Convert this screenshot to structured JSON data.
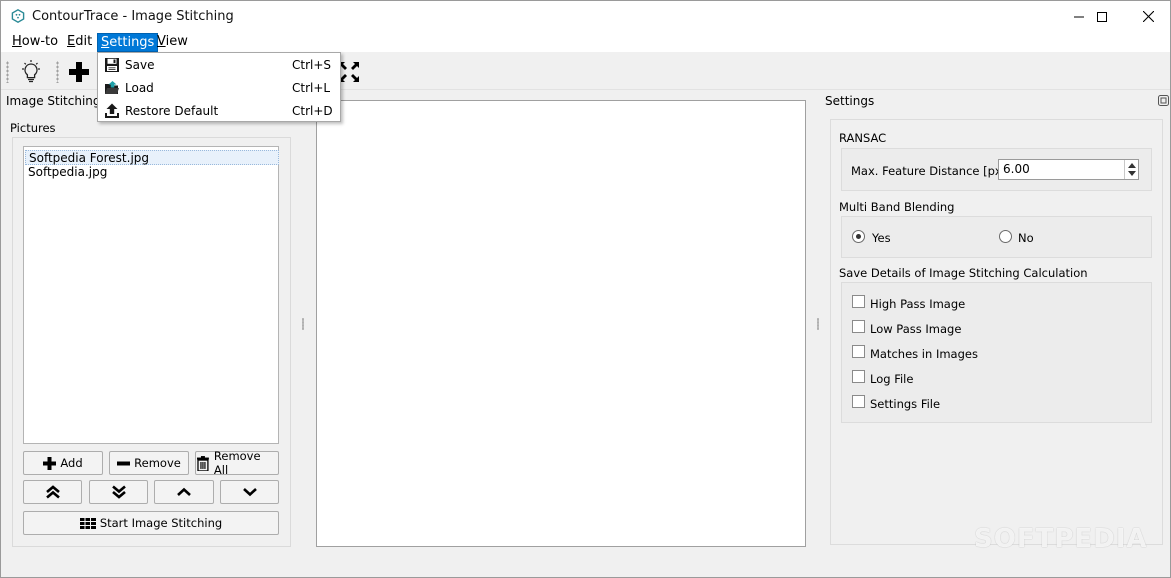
{
  "window": {
    "title": "ContourTrace - Image Stitching"
  },
  "menubar": {
    "items": [
      {
        "label": "How-to",
        "mnemonic": "H",
        "rest": "ow-to"
      },
      {
        "label": "Edit",
        "mnemonic": "E",
        "rest": "dit"
      },
      {
        "label": "Settings",
        "mnemonic": "S",
        "rest": "ettings"
      },
      {
        "label": "View",
        "mnemonic": "V",
        "rest": "iew"
      }
    ]
  },
  "settings_menu": {
    "items": [
      {
        "label": "Save",
        "shortcut": "Ctrl+S",
        "icon": "floppy-disk-icon"
      },
      {
        "label": "Load",
        "shortcut": "Ctrl+L",
        "icon": "open-folder-icon"
      },
      {
        "label": "Restore Default",
        "shortcut": "Ctrl+D",
        "icon": "upload-icon"
      }
    ]
  },
  "toolbar": {
    "icons": [
      "lightbulb-icon",
      "plus-icon",
      "fullscreen-icon"
    ]
  },
  "left_panel": {
    "title": "Image Stitching",
    "pictures_label": "Pictures",
    "pictures": [
      "Softpedia Forest.jpg",
      "Softpedia.jpg"
    ],
    "add_label": "Add",
    "remove_label": "Remove",
    "remove_all_label": "Remove All",
    "start_label": "Start Image Stitching"
  },
  "settings_panel": {
    "title": "Settings",
    "ransac": {
      "label": "RANSAC",
      "field_label": "Max. Feature Distance [px]:",
      "field_value": "6.00"
    },
    "blending": {
      "label": "Multi Band Blending",
      "yes_label": "Yes",
      "no_label": "No",
      "selected": "Yes"
    },
    "save_details": {
      "label": "Save Details of Image Stitching Calculation",
      "options": [
        {
          "label": "High Pass Image",
          "checked": false
        },
        {
          "label": "Low Pass Image",
          "checked": false
        },
        {
          "label": "Matches in Images",
          "checked": false
        },
        {
          "label": "Log File",
          "checked": false
        },
        {
          "label": "Settings File",
          "checked": false
        }
      ]
    }
  },
  "watermark": "SOFTPEDIA",
  "colors": {
    "accent": "#0078d7",
    "menu_selected_border": "#0062b0",
    "list_selection": "#e8f1fb"
  }
}
